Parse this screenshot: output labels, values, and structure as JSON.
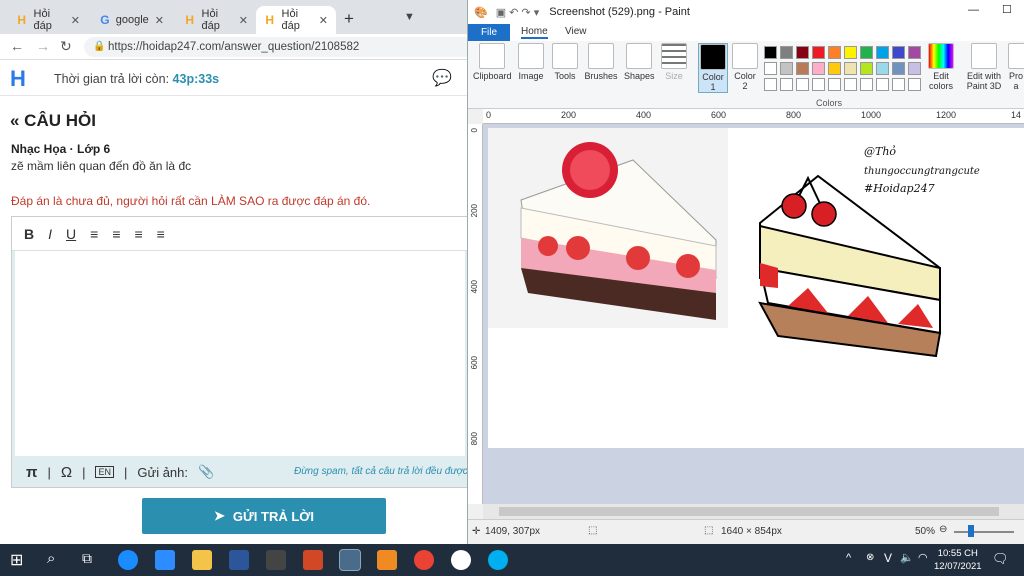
{
  "browser": {
    "tabs": [
      {
        "label": "Hỏi đáp",
        "icon": "H"
      },
      {
        "label": "google",
        "icon": "G"
      },
      {
        "label": "Hỏi đáp",
        "icon": "H"
      },
      {
        "label": "Hỏi đáp",
        "icon": "H",
        "active": true
      }
    ],
    "new_tab": "+",
    "url": "https://hoidap247.com/answer_question/2108582"
  },
  "site": {
    "logo": "H",
    "timer_label": "Thời gian trả lời còn:",
    "timer_value": "43p:33s",
    "question_title": "« CÂU HỎI",
    "subject": "Nhạc Họa · Lớp 6",
    "question_text": "zẽ mầm liên quan đến đồ ăn là đc",
    "warning": "Đáp án là chưa đủ, người hỏi rất cần LÀM SAO ra được đáp án đó.",
    "toolbar": [
      "B",
      "I",
      "U",
      "≡",
      "≡",
      "≡",
      "≡"
    ],
    "footer_items": [
      "π",
      "|",
      "Ω",
      "|",
      "EN",
      "|",
      "Gửi ảnh:",
      "📎"
    ],
    "spam_note": "Đừng spam, tất cả câu trả lời đều được kiểm duyệt",
    "submit_label": "GỬI TRẢ LỜI"
  },
  "paint": {
    "title": "Screenshot (529).png - Paint",
    "menu": {
      "file": "File",
      "home": "Home",
      "view": "View"
    },
    "ribbon": {
      "clipboard": "Clipboard",
      "image": "Image",
      "tools": "Tools",
      "brushes": "Brushes",
      "shapes": "Shapes",
      "size": "Size",
      "color1": "Color 1",
      "color2": "Color 2",
      "edit_colors": "Edit colors",
      "edit_paint3d": "Edit with Paint 3D",
      "product": "Pro a",
      "colors_label": "Colors"
    },
    "palette_row1": [
      "#000000",
      "#7f7f7f",
      "#880015",
      "#ed1c24",
      "#ff7f27",
      "#fff200",
      "#22b14c",
      "#00a2e8",
      "#3f48cc",
      "#a349a4"
    ],
    "palette_row2": [
      "#ffffff",
      "#c3c3c3",
      "#b97a57",
      "#ffaec9",
      "#ffc90e",
      "#efe4b0",
      "#b5e61d",
      "#99d9ea",
      "#7092be",
      "#c8bfe7"
    ],
    "hruler_ticks": [
      "0",
      "200",
      "400",
      "600",
      "800",
      "1000",
      "1200",
      "14"
    ],
    "vruler_ticks": [
      "0",
      "200",
      "400",
      "600",
      "800"
    ],
    "watermark": {
      "line1": "@Thỏ",
      "line2": "thungoccungtrangcute",
      "line3": "#Hoidap247"
    },
    "status": {
      "cursor": "1409, 307px",
      "size": "1640 × 854px",
      "zoom": "50%"
    }
  },
  "taskbar": {
    "time": "10:55 CH",
    "date": "12/07/2021",
    "lang": "V"
  }
}
